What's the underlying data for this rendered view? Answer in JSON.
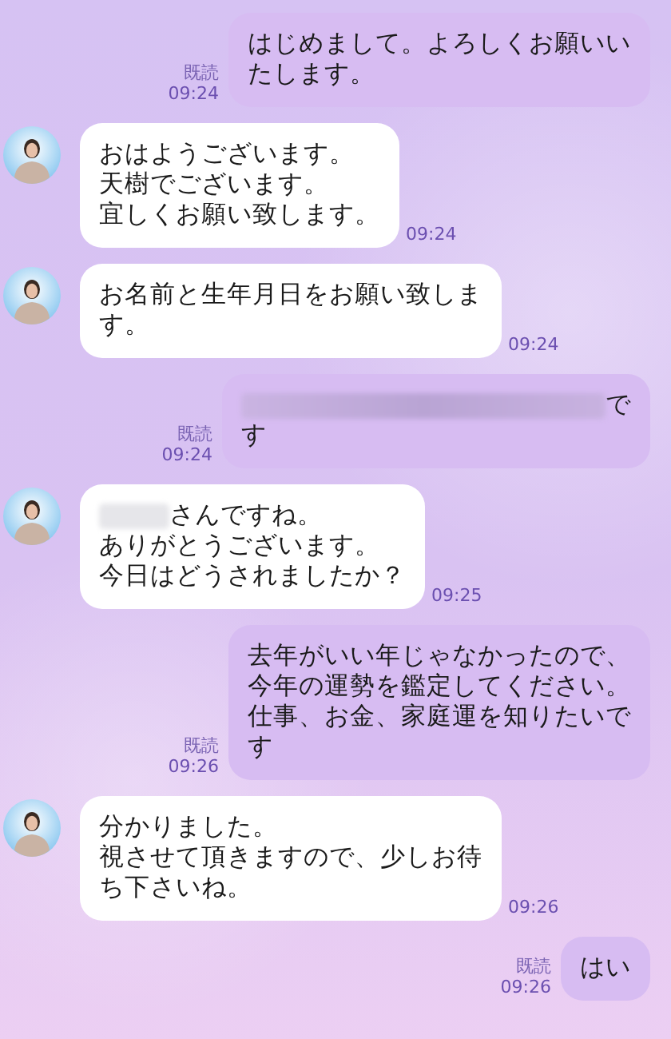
{
  "messages": [
    {
      "kind": "sent",
      "read": "既読",
      "time": "09:24",
      "lines": [
        {
          "redacted": false,
          "text": "はじめまして。よろしくお願いい"
        },
        {
          "redacted": false,
          "text": "たします。"
        }
      ]
    },
    {
      "kind": "received",
      "time": "09:24",
      "lines": [
        {
          "redacted": false,
          "text": "おはようございます。"
        },
        {
          "redacted": false,
          "text": "天樹でございます。"
        },
        {
          "redacted": false,
          "text": "宜しくお願い致します。"
        }
      ]
    },
    {
      "kind": "received",
      "time": "09:24",
      "lines": [
        {
          "redacted": false,
          "text": "お名前と生年月日をお願い致しま"
        },
        {
          "redacted": false,
          "text": "す。"
        }
      ]
    },
    {
      "kind": "sent",
      "read": "既読",
      "time": "09:24",
      "lines": [
        {
          "redacted": true,
          "text": "で"
        },
        {
          "redacted": false,
          "text": "す"
        }
      ]
    },
    {
      "kind": "received",
      "time": "09:25",
      "lines": [
        {
          "redacted": true,
          "text": "さんですね。"
        },
        {
          "redacted": false,
          "text": "ありがとうございます。"
        },
        {
          "redacted": false,
          "text": "今日はどうされましたか？"
        }
      ]
    },
    {
      "kind": "sent",
      "read": "既読",
      "time": "09:26",
      "lines": [
        {
          "redacted": false,
          "text": "去年がいい年じゃなかったので、"
        },
        {
          "redacted": false,
          "text": "今年の運勢を鑑定してください。"
        },
        {
          "redacted": false,
          "text": "仕事、お金、家庭運を知りたいで"
        },
        {
          "redacted": false,
          "text": "す"
        }
      ]
    },
    {
      "kind": "received",
      "time": "09:26",
      "lines": [
        {
          "redacted": false,
          "text": "分かりました。"
        },
        {
          "redacted": false,
          "text": "視させて頂きますので、少しお待"
        },
        {
          "redacted": false,
          "text": "ち下さいね。"
        }
      ]
    },
    {
      "kind": "sent",
      "read": "既読",
      "time": "09:26",
      "lines": [
        {
          "redacted": false,
          "text": "はい"
        }
      ]
    }
  ]
}
